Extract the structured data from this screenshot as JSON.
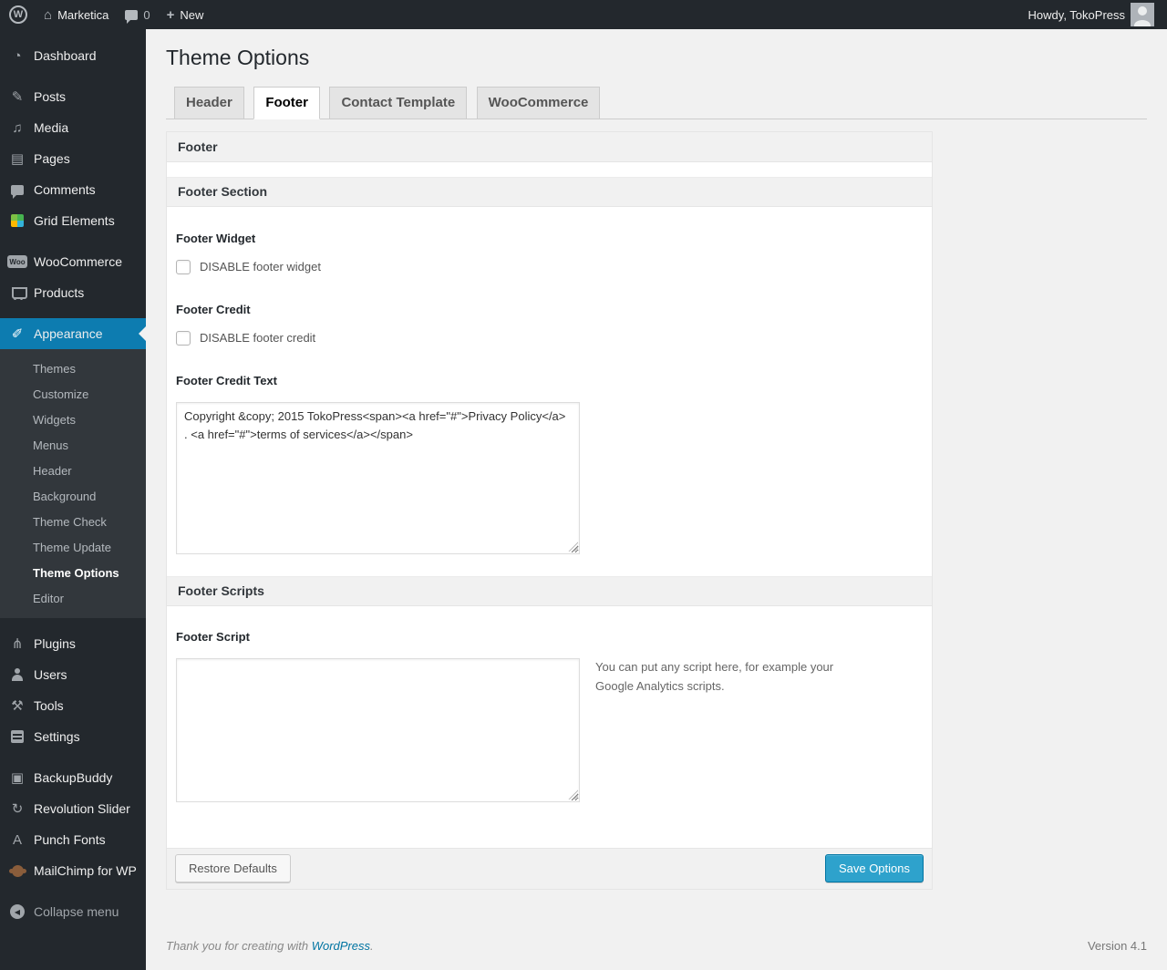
{
  "admin_bar": {
    "wp_logo_glyph": "W",
    "home_glyph": "⌂",
    "site_name": "Marketica",
    "comment_count": "0",
    "plus_glyph": "+",
    "new_label": "New",
    "howdy": "Howdy, TokoPress"
  },
  "sidebar": {
    "items": [
      {
        "label": "Dashboard",
        "glyph": "◔"
      },
      {
        "label": "Posts",
        "glyph": "✎"
      },
      {
        "label": "Media",
        "glyph": "♫"
      },
      {
        "label": "Pages",
        "glyph": "▤"
      },
      {
        "label": "Comments",
        "glyph": ""
      },
      {
        "label": "Grid Elements",
        "glyph": ""
      },
      {
        "label": "WooCommerce",
        "glyph": "",
        "badge": "Woo"
      },
      {
        "label": "Products",
        "glyph": ""
      },
      {
        "label": "Appearance",
        "glyph": "✐"
      },
      {
        "label": "Plugins",
        "glyph": "⋔"
      },
      {
        "label": "Users",
        "glyph": ""
      },
      {
        "label": "Tools",
        "glyph": "⚒"
      },
      {
        "label": "Settings",
        "glyph": ""
      },
      {
        "label": "BackupBuddy",
        "glyph": "▣"
      },
      {
        "label": "Revolution Slider",
        "glyph": "↻"
      },
      {
        "label": "Punch Fonts",
        "glyph": "A"
      },
      {
        "label": "MailChimp for WP",
        "glyph": ""
      },
      {
        "label": "Collapse menu",
        "glyph": "◀"
      }
    ],
    "submenu": [
      "Themes",
      "Customize",
      "Widgets",
      "Menus",
      "Header",
      "Background",
      "Theme Check",
      "Theme Update",
      "Theme Options",
      "Editor"
    ]
  },
  "page": {
    "title": "Theme Options",
    "tabs": [
      {
        "label": "Header"
      },
      {
        "label": "Footer"
      },
      {
        "label": "Contact Template"
      },
      {
        "label": "WooCommerce"
      }
    ],
    "panel": {
      "section_footer_title": "Footer",
      "section_footer_section_title": "Footer Section",
      "footer_widget_label": "Footer Widget",
      "footer_widget_checkbox_label": "DISABLE footer widget",
      "footer_credit_label": "Footer Credit",
      "footer_credit_checkbox_label": "DISABLE footer credit",
      "footer_credit_text_label": "Footer Credit Text",
      "footer_credit_text_value": "Copyright &copy; 2015 TokoPress<span><a href=\"#\">Privacy Policy</a> . <a href=\"#\">terms of services</a></span>",
      "section_footer_scripts_title": "Footer Scripts",
      "footer_script_label": "Footer Script",
      "footer_script_value": "",
      "footer_script_help": "You can put any script here, for example your Google Analytics scripts.",
      "restore_button": "Restore Defaults",
      "save_button": "Save Options"
    },
    "footer": {
      "thanks_prefix": "Thank you for creating with ",
      "wordpress_link": "WordPress",
      "thanks_suffix": ".",
      "version": "Version 4.1"
    }
  },
  "colors": {
    "adminbar_bg": "#23282d",
    "menu_active_bg": "#0d7cb0",
    "page_bg": "#f1f1f1",
    "primary_button_bg": "#2ea2cc",
    "link_blue": "#0074a2"
  }
}
